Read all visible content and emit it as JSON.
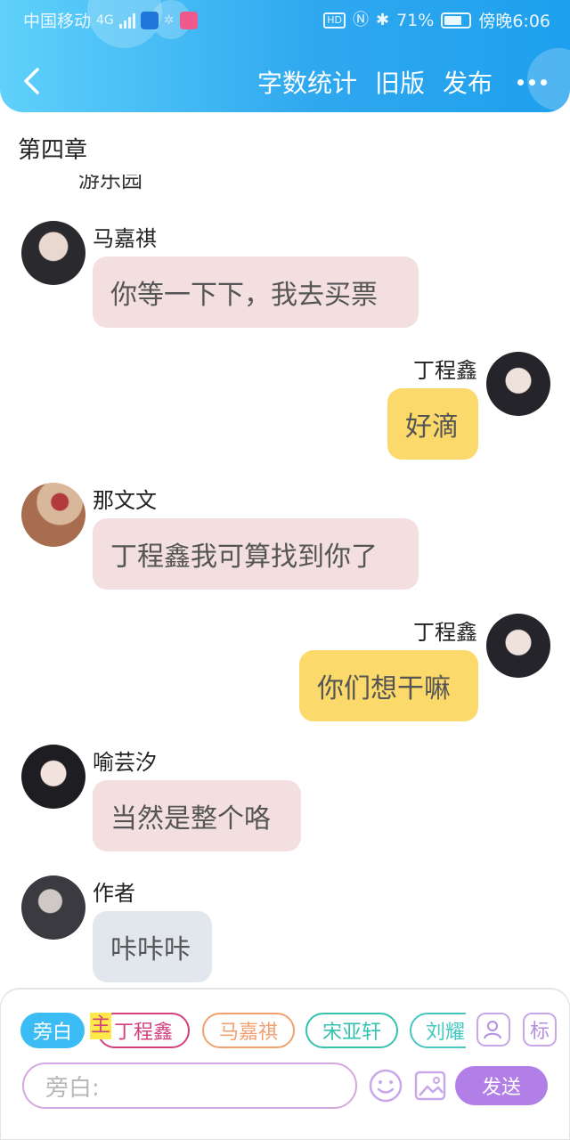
{
  "status_bar": {
    "carrier": "中国移动",
    "network": "4G",
    "battery": "71%",
    "time": "傍晚6:06",
    "hd_label": "HD"
  },
  "nav": {
    "word_count": "字数统计",
    "old_version": "旧版",
    "publish": "发布"
  },
  "chapter": {
    "title": "第四章",
    "cut_text": "游乐园"
  },
  "messages": [
    {
      "sender": "马嘉祺",
      "text": "你等一下下，我去买票",
      "side": "left",
      "style": "pink"
    },
    {
      "sender": "丁程鑫",
      "text": "好滴",
      "side": "right",
      "style": "yellow"
    },
    {
      "sender": "那文文",
      "text": "丁程鑫我可算找到你了",
      "side": "left",
      "style": "pink"
    },
    {
      "sender": "丁程鑫",
      "text": "你们想干嘛",
      "side": "right",
      "style": "yellow"
    },
    {
      "sender": "喻芸汐",
      "text": "当然是整个咯",
      "side": "left",
      "style": "pink"
    },
    {
      "sender": "作者",
      "text": "咔咔咔",
      "side": "left",
      "style": "gray"
    }
  ],
  "composer": {
    "chips": [
      "旁白",
      "丁程鑫",
      "马嘉祺",
      "宋亚轩",
      "刘耀"
    ],
    "main_mark": "主",
    "tag_button": "标",
    "input_placeholder": "旁白:",
    "send_label": "发送"
  },
  "colors": {
    "header_start": "#5fd1fb",
    "header_end": "#1ea0ee",
    "bubble_pink": "#f3dfe0",
    "bubble_yellow": "#fbd96a",
    "bubble_gray": "#e2e7ee",
    "send_purple": "#b27fe6"
  }
}
